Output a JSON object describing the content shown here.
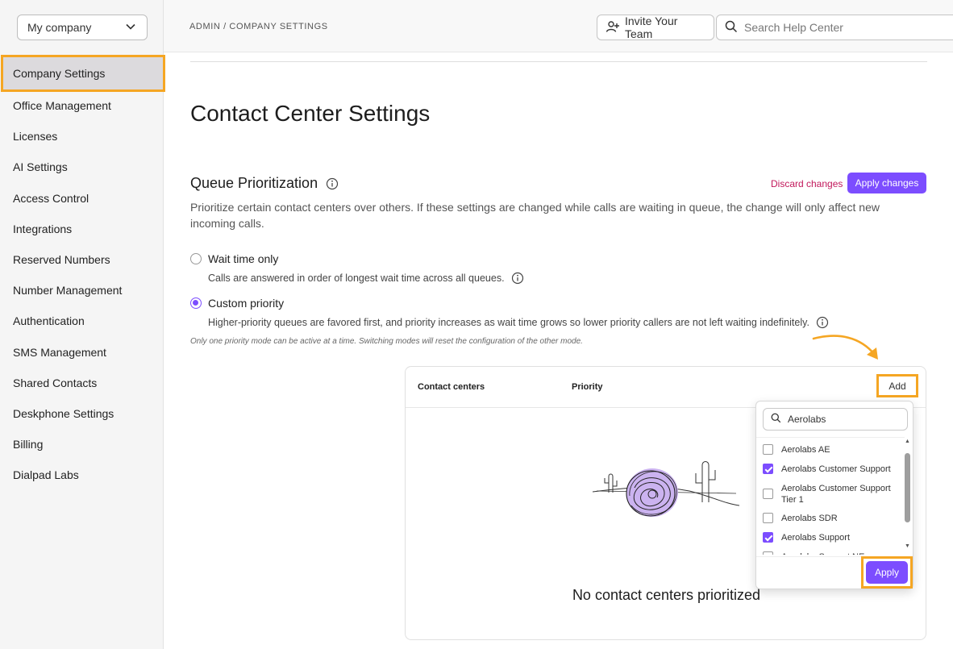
{
  "sidebar": {
    "company_select": "My company",
    "items": [
      {
        "label": "Company Settings",
        "active": true
      },
      {
        "label": "Office Management"
      },
      {
        "label": "Licenses"
      },
      {
        "label": "AI Settings"
      },
      {
        "label": "Access Control"
      },
      {
        "label": "Integrations"
      },
      {
        "label": "Reserved Numbers"
      },
      {
        "label": "Number Management"
      },
      {
        "label": "Authentication"
      },
      {
        "label": "SMS Management"
      },
      {
        "label": "Shared Contacts"
      },
      {
        "label": "Deskphone Settings"
      },
      {
        "label": "Billing"
      },
      {
        "label": "Dialpad Labs"
      }
    ]
  },
  "topbar": {
    "breadcrumb": "ADMIN / COMPANY SETTINGS",
    "invite_label": "Invite Your Team",
    "search_placeholder": "Search Help Center"
  },
  "main": {
    "page_title": "Contact Center Settings",
    "section_title": "Queue Prioritization",
    "discard_label": "Discard changes",
    "apply_changes_label": "Apply changes",
    "description": "Prioritize certain contact centers over others. If these settings are changed while calls are waiting in queue, the change will only affect new incoming calls.",
    "options": [
      {
        "label": "Wait time only",
        "subtext": "Calls are answered in order of longest wait time across all queues.",
        "selected": false
      },
      {
        "label": "Custom priority",
        "subtext": "Higher-priority queues are favored first, and priority increases as wait time grows so lower priority callers are not left waiting indefinitely.",
        "selected": true
      }
    ],
    "note": "Only one priority mode can be active at a time. Switching modes will reset the configuration of the other mode."
  },
  "card": {
    "col_contact_centers": "Contact centers",
    "col_priority": "Priority",
    "add_label": "Add",
    "empty_title": "No contact centers prioritized"
  },
  "dropdown": {
    "search_value": "Aerolabs",
    "items": [
      {
        "label": "Aerolabs AE",
        "checked": false
      },
      {
        "label": "Aerolabs Customer Support",
        "checked": true
      },
      {
        "label": "Aerolabs Customer Support Tier 1",
        "checked": false
      },
      {
        "label": "Aerolabs SDR",
        "checked": false
      },
      {
        "label": "Aerolabs Support",
        "checked": true
      },
      {
        "label": "Aerolabs Support NE",
        "checked": false
      }
    ],
    "apply_label": "Apply"
  },
  "colors": {
    "accent": "#7c4dff",
    "highlight": "#f5a623",
    "discard": "#c2185b"
  }
}
